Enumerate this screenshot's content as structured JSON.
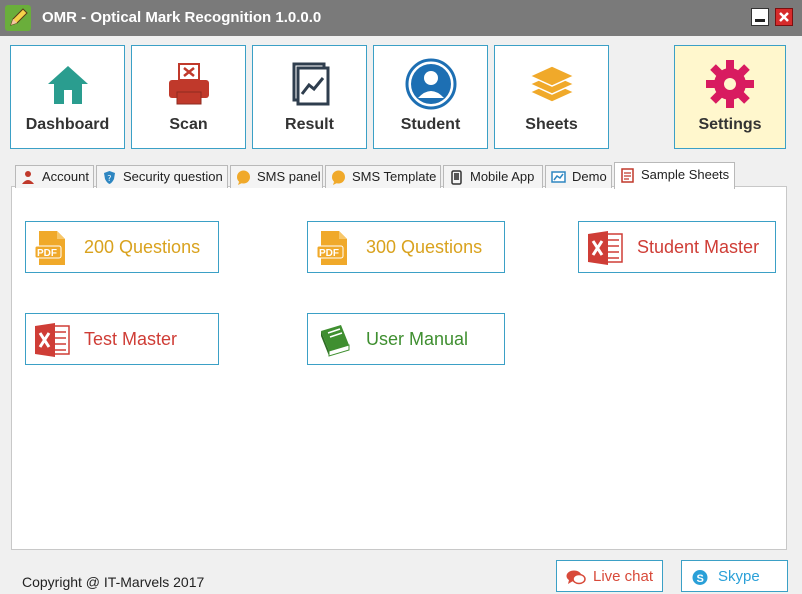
{
  "window": {
    "title": "OMR - Optical Mark Recognition 1.0.0.0",
    "icons": [
      "pencil-icon",
      "minimize-icon",
      "close-icon"
    ]
  },
  "toolbar": [
    {
      "id": "dashboard",
      "label": "Dashboard",
      "icon": "home-icon",
      "active": false
    },
    {
      "id": "scan",
      "label": "Scan",
      "icon": "printer-icon",
      "active": false
    },
    {
      "id": "result",
      "label": "Result",
      "icon": "chart-icon",
      "active": false
    },
    {
      "id": "student",
      "label": "Student",
      "icon": "user-icon",
      "active": false
    },
    {
      "id": "sheets",
      "label": "Sheets",
      "icon": "layers-icon",
      "active": false
    },
    {
      "id": "settings",
      "label": "Settings",
      "icon": "gear-icon",
      "active": true
    }
  ],
  "tabs": [
    {
      "id": "account",
      "label": "Account",
      "icon": "account-icon"
    },
    {
      "id": "security",
      "label": "Security question",
      "icon": "shield-icon"
    },
    {
      "id": "sms-panel",
      "label": "SMS panel",
      "icon": "sms-icon"
    },
    {
      "id": "sms-template",
      "label": "SMS Template",
      "icon": "sms-icon"
    },
    {
      "id": "mobile-app",
      "label": "Mobile App",
      "icon": "mobile-icon"
    },
    {
      "id": "demo",
      "label": "Demo",
      "icon": "demo-icon"
    },
    {
      "id": "sample-sheets",
      "label": "Sample Sheets",
      "icon": "document-icon",
      "active": true
    }
  ],
  "sample_sheets": [
    {
      "label": "200 Questions",
      "icon": "pdf-icon",
      "color": "#d9a21e"
    },
    {
      "label": "300 Questions",
      "icon": "pdf-icon",
      "color": "#d9a21e"
    },
    {
      "label": "Student Master",
      "icon": "excel-icon",
      "color": "#cf3d36"
    },
    {
      "label": "Test Master",
      "icon": "excel-icon",
      "color": "#cf3d36"
    },
    {
      "label": "User Manual",
      "icon": "book-icon",
      "color": "#3f8f30"
    }
  ],
  "footer": {
    "copyright": "Copyright @ IT-Marvels 2017",
    "live_chat": "Live chat",
    "skype": "Skype"
  },
  "colors": {
    "accent": "#3ba0c6",
    "titlebar": "#7a7a7a",
    "active_button": "#fff7cd"
  }
}
